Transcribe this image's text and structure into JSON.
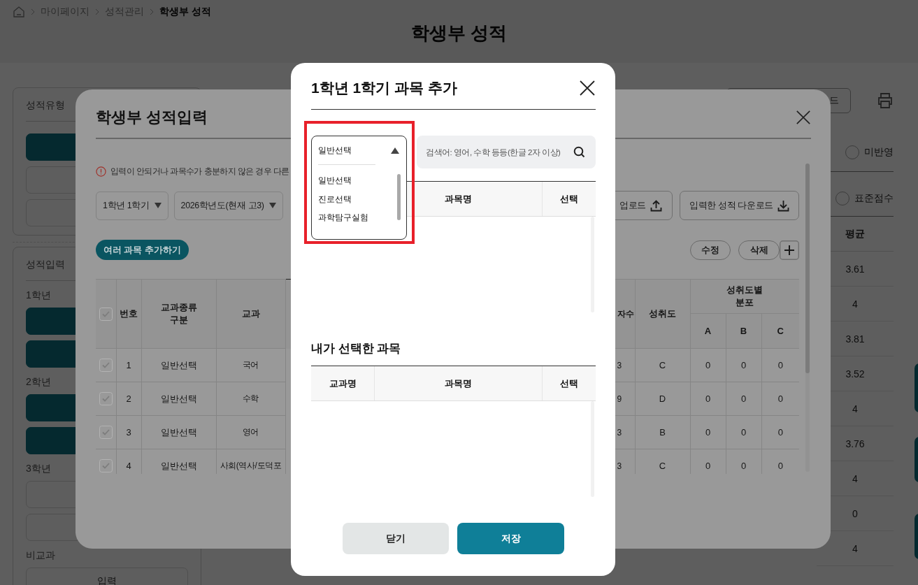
{
  "breadcrumb": [
    {
      "label": "마이페이지",
      "current": false
    },
    {
      "label": "성적관리",
      "current": false
    },
    {
      "label": "학생부 성적",
      "current": true
    }
  ],
  "page_title": "학생부 성적",
  "sidebar": [
    {
      "title": "성적유형",
      "groups": [
        {
          "buttons": [
            {
              "selected": true
            },
            {
              "selected": false
            },
            {
              "selected": false
            }
          ]
        }
      ]
    },
    {
      "title": "성적입력",
      "groups": [
        {
          "label": "1학년",
          "buttons": [
            {
              "selected": true
            },
            {
              "selected": true
            }
          ]
        },
        {
          "label": "2학년",
          "buttons": [
            {
              "selected": true
            },
            {
              "selected": true
            }
          ]
        },
        {
          "label": "3학년",
          "buttons": [
            {
              "selected": false
            },
            {
              "selected": false
            }
          ]
        },
        {
          "label": "비교과",
          "buttons": [
            {
              "label": "입력",
              "selected": false
            }
          ]
        }
      ]
    }
  ],
  "toolbar": {
    "download_button": "드"
  },
  "score_options": [
    {
      "label": "미반영",
      "selected": false
    },
    {
      "label": "표준점수",
      "selected": false
    }
  ],
  "average_table": {
    "column": "평균",
    "rows": [
      "3.61",
      "4",
      "3.81",
      "3.52",
      "4",
      "3.76",
      "4",
      "0",
      "4"
    ]
  },
  "score_input_modal": {
    "title": "학생부 성적입력",
    "notice": "입력이 안되거나 과목수가 충분하지 않은 경우 다른",
    "selects": [
      "1학년 1학기",
      "2026학년도(현재 고3)"
    ],
    "add_button": "여러 과목 추가하기",
    "file_buttons": [
      {
        "label": "업로드",
        "kind": "upload"
      },
      {
        "label": "입력한 성적 다운로드",
        "kind": "download"
      }
    ],
    "edit_button": "수정",
    "delete_button": "삭제",
    "table": {
      "select_all_checked": true,
      "columns": [
        "번호",
        "교과종류 구분",
        "교과"
      ],
      "columns_right": [
        "자수",
        "성취도"
      ],
      "group_column": "성취도별 분포",
      "group_subcolumns": [
        "A",
        "B",
        "C"
      ],
      "rows": [
        {
          "checked": true,
          "number": "1",
          "category": "일반선택",
          "subject": "국어",
          "column_cut": "3",
          "achievement": "C",
          "distribution": [
            "0",
            "0",
            "0"
          ]
        },
        {
          "checked": true,
          "number": "2",
          "category": "일반선택",
          "subject": "수학",
          "column_cut": "9",
          "achievement": "D",
          "distribution": [
            "0",
            "0",
            "0"
          ]
        },
        {
          "checked": true,
          "number": "3",
          "category": "일반선택",
          "subject": "영어",
          "column_cut": "3",
          "achievement": "B",
          "distribution": [
            "0",
            "0",
            "0"
          ]
        },
        {
          "checked": true,
          "number": "4",
          "category": "일반선택",
          "subject": "사회(역사/도덕포",
          "column_cut": "3",
          "achievement": "C",
          "distribution": [
            "0",
            "0",
            "0"
          ]
        }
      ]
    }
  },
  "subject_modal": {
    "title": "1학년 1학기 과목 추가",
    "dropdown": {
      "value": "일반선택",
      "expanded": true,
      "highlighted": true,
      "options": [
        {
          "label": "일반선택"
        },
        {
          "label": "진로선택"
        },
        {
          "label": "과학탐구실험"
        }
      ]
    },
    "search": {
      "placeholder": "검색어: 영어, 수학 등등(한글 2자 이상)"
    },
    "subject_table": {
      "columns": [
        "과목명",
        "선택"
      ]
    },
    "selected_title": "내가 선택한 과목",
    "selected_table": {
      "columns": [
        "교과명",
        "과목명",
        "선택"
      ]
    },
    "buttons": [
      {
        "label": "닫기",
        "kind": "secondary"
      },
      {
        "label": "저장",
        "kind": "primary"
      }
    ]
  }
}
